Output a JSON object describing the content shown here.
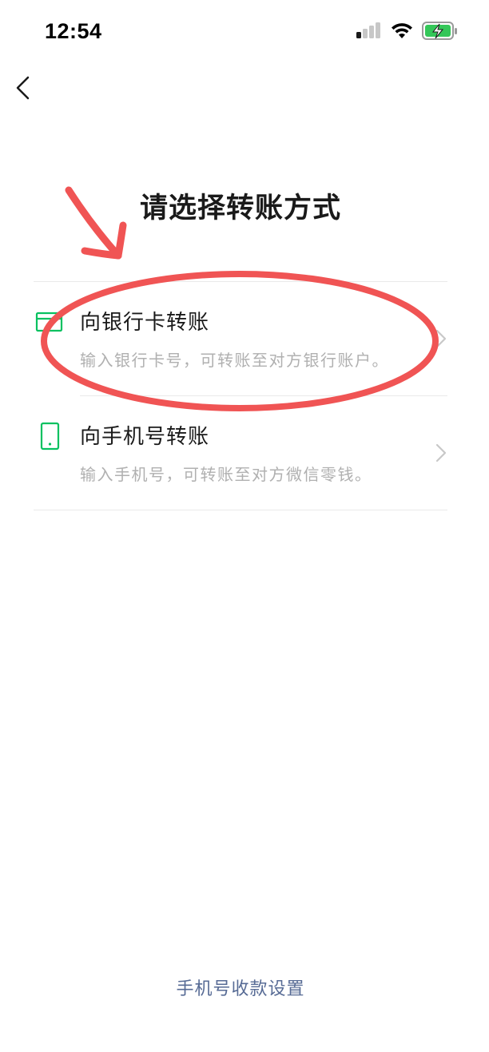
{
  "status_bar": {
    "time": "12:54",
    "icons": [
      "cellular-signal-icon",
      "wifi-icon",
      "battery-charging-icon"
    ]
  },
  "nav": {
    "back_icon": "chevron-left-icon"
  },
  "page": {
    "title": "请选择转账方式"
  },
  "options": [
    {
      "icon": "bank-card-icon",
      "title": "向银行卡转账",
      "description": "输入银行卡号，可转账至对方银行账户。"
    },
    {
      "icon": "mobile-phone-icon",
      "title": "向手机号转账",
      "description": "输入手机号，可转账至对方微信零钱。"
    }
  ],
  "footer": {
    "link_label": "手机号收款设置"
  },
  "colors": {
    "accent_green": "#07c160",
    "link_blue": "#576b95",
    "annotation_red": "#f05454",
    "secondary_text": "#b0b0b0"
  }
}
